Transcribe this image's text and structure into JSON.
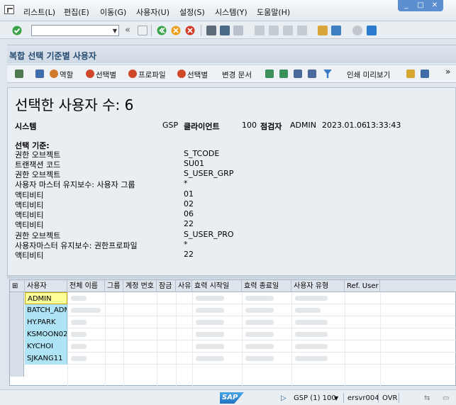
{
  "menubar": {
    "items": [
      "리스트(L)",
      "편집(E)",
      "이동(G)",
      "사용자(U)",
      "설정(S)",
      "시스템(Y)",
      "도움말(H)"
    ]
  },
  "window_controls": {
    "minimize": "_",
    "restore": "□",
    "close": "✕"
  },
  "toolbar": {
    "command_field_value": "",
    "back_glyph": "«"
  },
  "title": "복합 선택 기준별 사용자",
  "app_toolbar": {
    "role": "역할",
    "selection1": "선택별",
    "profile": "프로파일",
    "selection2": "선택별",
    "change_docs": "변경 문서",
    "print_preview": "인쇄 미리보기",
    "more": "»"
  },
  "report": {
    "heading": "선택한 사용자 수: 6",
    "system_label": "시스템",
    "system_value": "GSP",
    "client_label": "클라이언트",
    "client_value": "100",
    "checker_label": "점검자",
    "checker_value": "ADMIN",
    "date": "2023.01.06",
    "time": "13:33:43",
    "criteria_title": "선택 기준:",
    "criteria": [
      {
        "label": "권한 오브젝트",
        "value": "S_TCODE"
      },
      {
        "label": "트랜잭션 코드",
        "value": "SU01"
      },
      {
        "label": "권한 오브젝트",
        "value": "S_USER_GRP"
      },
      {
        "label": "사용자 마스터 유지보수: 사용자 그룹",
        "value": "*"
      },
      {
        "label": "액티비티",
        "value": "01"
      },
      {
        "label": "액티비티",
        "value": "02"
      },
      {
        "label": "액티비티",
        "value": "06"
      },
      {
        "label": "액티비티",
        "value": "22"
      },
      {
        "label": "권한 오브젝트",
        "value": "S_USER_PRO"
      },
      {
        "label": "사용자마스터 유지보수: 권한프로파일",
        "value": "*"
      },
      {
        "label": "액티비티",
        "value": "22"
      }
    ]
  },
  "grid": {
    "columns": [
      "사용자",
      "전체 이름",
      "그룹",
      "계정 번호",
      "잠금",
      "사유",
      "효력 시작일",
      "효력 종료일",
      "사용자 유형",
      "Ref. User"
    ],
    "rows": [
      "ADMIN",
      "BATCH_ADM",
      "HY.PARK",
      "KSMOON02",
      "KYCHOI",
      "SJKANG11"
    ]
  },
  "status": {
    "sap_logo": "SAP",
    "session": "GSP (1) 100",
    "server": "ersvr004",
    "mode": "OVR"
  },
  "colors": {
    "accent": "#24496e",
    "user_cell": "#aee4f5",
    "focus_cell": "#ffff99"
  }
}
